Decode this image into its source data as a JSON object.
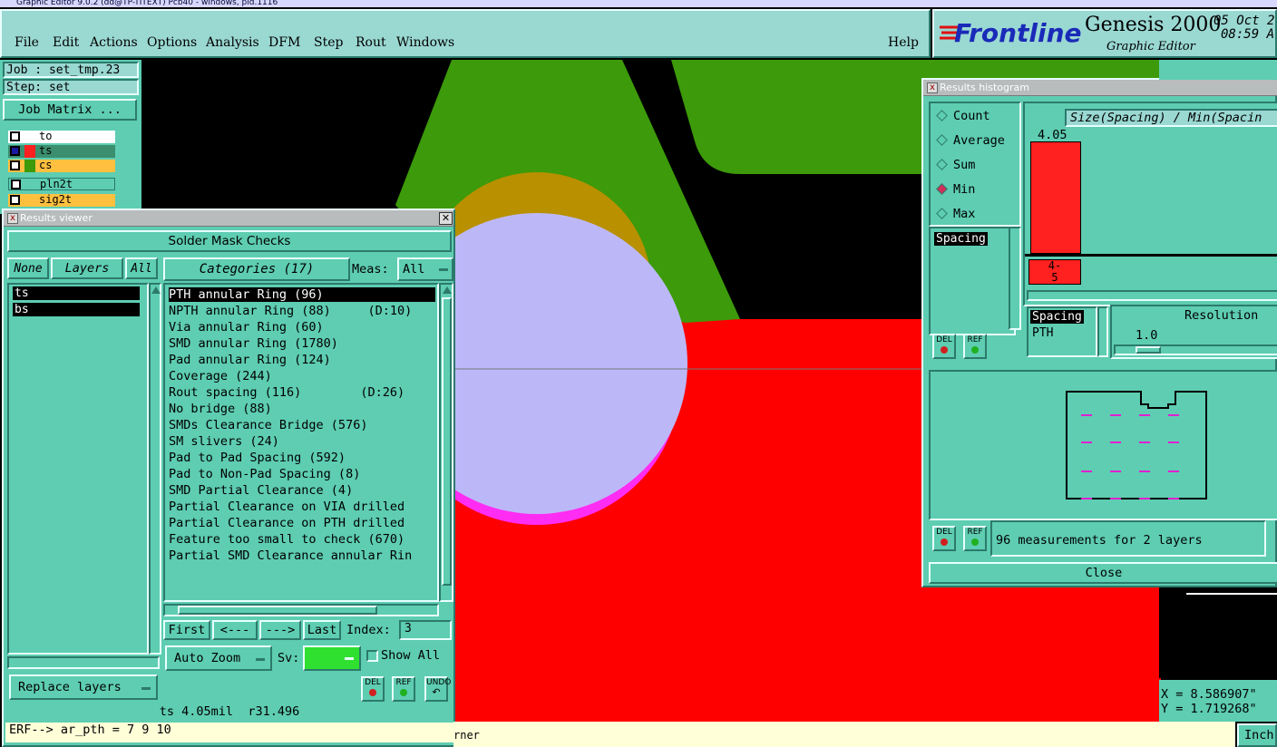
{
  "window_title": "Graphic Editor 9.0.2 (dd@TP-TITEXT) Pcb40 - windows, pid.1116",
  "menu": [
    "File",
    "Edit",
    "Actions",
    "Options",
    "Analysis",
    "DFM",
    "Step",
    "Rout",
    "Windows"
  ],
  "help_label": "Help",
  "brand": {
    "logo": "Frontline",
    "product": "Genesis 2000",
    "subtitle": "Graphic Editor",
    "date": "05 Oct 2",
    "time": "08:59 A"
  },
  "left_panel": {
    "job": "Job : set_tmp.23",
    "step": "Step: set",
    "job_matrix": "Job Matrix ...",
    "layers": [
      "to",
      "ts",
      "cs",
      "pln2t",
      "sig2t"
    ]
  },
  "results_viewer": {
    "title": "Results viewer",
    "header": "Solder Mask Checks",
    "none_label": "None",
    "layers_label": "Layers",
    "all_label": "All",
    "categories_label": "Categories (17)",
    "meas_label": "Meas:",
    "meas_value": "All",
    "layer_items": [
      "ts",
      "bs"
    ],
    "categories": [
      "PTH annular Ring (96)",
      "NPTH annular Ring (88)     (D:10)",
      "Via annular Ring (60)",
      "SMD annular Ring (1780)",
      "Pad annular Ring (124)",
      "Coverage (244)",
      "Rout spacing (116)        (D:26)",
      "No bridge (88)",
      "SMDs Clearance Bridge (576)",
      "SM slivers (24)",
      "Pad to Pad Spacing (592)",
      "Pad to Non-Pad Spacing (8)",
      "SMD Partial Clearance (4)",
      "Partial Clearance on VIA drilled",
      "Partial Clearance on PTH drilled",
      "Feature too small to check (670)",
      "Partial SMD Clearance annular Rin"
    ],
    "nav": {
      "first": "First",
      "prev": "<---",
      "next": "--->",
      "last": "Last",
      "index_label": "Index:",
      "index_value": "3"
    },
    "auto_zoom": "Auto Zoom",
    "sv_label": "Sv:",
    "show_all": "Show All",
    "replace_layers": "Replace layers",
    "del": "DEL",
    "ref": "REF",
    "undo": "UNDO",
    "status": "ts 4.05mil  r31.496",
    "erf": "ERF--> ar_pth = 7 9 10"
  },
  "histogram": {
    "title": "Results histogram",
    "options": [
      "Count",
      "Average",
      "Sum",
      "Min",
      "Max"
    ],
    "selected": "Min",
    "chart_title": "Size(Spacing) / Min(Spacin",
    "bar_value": "4.05",
    "bin_label_1": "4-",
    "bin_label_2": "5",
    "list1": [
      "Spacing"
    ],
    "list2": [
      "Spacing",
      "PTH"
    ],
    "resolution_label": "Resolution",
    "resolution_value": "1.0",
    "measurements": "96 measurements for 2 layers",
    "close": "Close",
    "del": "DEL",
    "ref": "REF"
  },
  "coords": {
    "x": "X = 8.586907\"",
    "y": "Y = 1.719268\""
  },
  "bottom_status": "rner",
  "units": "Inch",
  "colors": {
    "teal": "#5ecdb2",
    "copper_green": "#3d9a0a",
    "mask_red": "#ff0000",
    "annular_gold": "#b89000",
    "pad_lavender": "#bcb8f8",
    "ring_magenta": "#ff2cf4",
    "hist_bar": "#ff2020"
  }
}
